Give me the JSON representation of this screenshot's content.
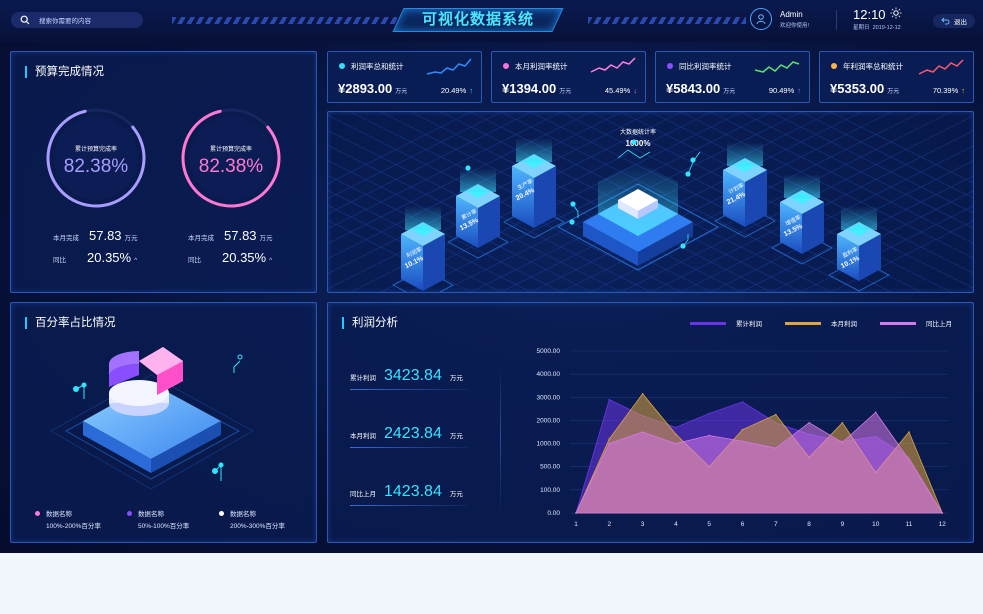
{
  "header": {
    "search_placeholder": "搜索你需要的内容",
    "title": "可视化数据系统",
    "user_name": "Admin",
    "user_greeting": "欢迎你使用!",
    "time": "12:10",
    "weekday": "星期日",
    "date": "2019-12-12",
    "logout_label": "退出"
  },
  "budget": {
    "title": "预算完成情况",
    "rings": [
      {
        "label": "累计预算完成率",
        "value": "82.38%",
        "fraction": 0.8238,
        "color": "#a99cff"
      },
      {
        "label": "累计预算完成率",
        "value": "82.38%",
        "fraction": 0.8238,
        "color": "#ff79d2"
      }
    ],
    "stats": [
      {
        "label": "本月完成",
        "value": "57.83",
        "unit": "万元",
        "yoy_label": "同比",
        "yoy_value": "20.35%",
        "arrow": "^"
      },
      {
        "label": "本月完成",
        "value": "57.83",
        "unit": "万元",
        "yoy_label": "同比",
        "yoy_value": "20.35%",
        "arrow": "^"
      }
    ]
  },
  "kpis": [
    {
      "label": "利润率总和统计",
      "value": "¥2893.00",
      "unit": "万元",
      "pct": "20.49%",
      "arrow": "↑",
      "dot_color": "#2fe0ff",
      "arrow_color": "#2fe0ff",
      "line_color": "#2f8cff"
    },
    {
      "label": "本月利润率统计",
      "value": "¥1394.00",
      "unit": "万元",
      "pct": "45.49%",
      "arrow": "↓",
      "dot_color": "#ff6fd8",
      "arrow_color": "#ff6fd8",
      "line_color": "#ff7fe6"
    },
    {
      "label": "同比利润率统计",
      "value": "¥5843.00",
      "unit": "万元",
      "pct": "90.49%",
      "arrow": "↑",
      "dot_color": "#8c4dff",
      "arrow_color": "#9d6bff",
      "line_color": "#5fe07a"
    },
    {
      "label": "年利润率总和统计",
      "value": "¥5353.00",
      "unit": "万元",
      "pct": "70.39%",
      "arrow": "↑",
      "dot_color": "#ffb347",
      "arrow_color": "#ffb347",
      "line_color": "#ff5a6e"
    }
  ],
  "iso_center": {
    "label": "大数据统计率",
    "value": "1000%"
  },
  "iso_blocks": [
    {
      "label": "利润率",
      "value": "10.1%"
    },
    {
      "label": "累计率",
      "value": "13.5%"
    },
    {
      "label": "生产率",
      "value": "20.4%"
    },
    {
      "label": "计划率",
      "value": "21.4%"
    },
    {
      "label": "增值率",
      "value": "13.5%"
    },
    {
      "label": "盈利率",
      "value": "10.1%"
    }
  ],
  "percent": {
    "title": "百分率占比情况",
    "legend": [
      {
        "label": "数据名称",
        "range": "100%-200%百分率",
        "color": "#ff78de"
      },
      {
        "label": "数据名称",
        "range": "50%-100%百分率",
        "color": "#8a4dff"
      },
      {
        "label": "数据名称",
        "range": "200%-300%百分率",
        "color": "#ffffff"
      }
    ]
  },
  "profit": {
    "title": "利润分析",
    "rows": [
      {
        "label": "累计利润",
        "value": "3423.84",
        "unit": "万元"
      },
      {
        "label": "本月利润",
        "value": "2423.84",
        "unit": "万元"
      },
      {
        "label": "同比上月",
        "value": "1423.84",
        "unit": "万元"
      }
    ]
  },
  "chart_data": {
    "type": "area",
    "x": [
      1,
      2,
      3,
      4,
      5,
      6,
      7,
      8,
      9,
      10,
      11,
      12
    ],
    "ylim": [
      0,
      5000
    ],
    "yticks": [
      "5000.00",
      "4000.00",
      "3000.00",
      "2000.00",
      "1000.00",
      "500.00",
      "100.00",
      "0.00"
    ],
    "xticks": [
      "1",
      "2",
      "3",
      "4",
      "5",
      "6",
      "7",
      "8",
      "9",
      "10",
      "11",
      "12"
    ],
    "series": [
      {
        "name": "累计利润",
        "color": "#6a35e8",
        "values": [
          0,
          2900,
          2200,
          1700,
          2300,
          2800,
          1900,
          1400,
          1100,
          1300,
          700,
          0
        ]
      },
      {
        "name": "本月利润",
        "color": "#e0a43a",
        "values": [
          0,
          1200,
          3150,
          1400,
          500,
          1600,
          2250,
          700,
          1900,
          400,
          1500,
          0
        ]
      },
      {
        "name": "同比上月",
        "color": "#d778e8",
        "values": [
          0,
          1000,
          1500,
          1000,
          1350,
          1100,
          900,
          1900,
          1050,
          2350,
          650,
          0
        ]
      }
    ]
  }
}
